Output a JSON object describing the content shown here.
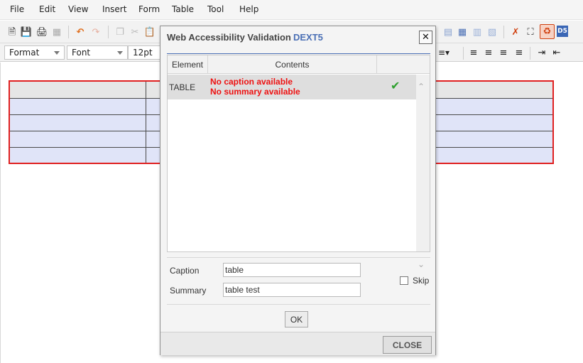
{
  "menubar": {
    "items": [
      "File",
      "Edit",
      "View",
      "Insert",
      "Form",
      "Table",
      "Tool",
      "Help"
    ]
  },
  "toolbar": {
    "format_label": "Format",
    "font_label": "Font",
    "size_label": "12pt",
    "icons": [
      "new-document-icon",
      "save-icon",
      "print-icon",
      "print-preview-icon",
      "undo-icon",
      "redo-icon",
      "copy-icon",
      "cut-icon",
      "paste-icon",
      "table-icon",
      "accessibility-icon",
      "dext5-icon",
      "list-icon",
      "align-left-icon",
      "align-center-icon",
      "align-right-icon",
      "align-justify-icon",
      "indent-icon",
      "outdent-icon"
    ]
  },
  "dialog": {
    "title": "Web Accessibility Validation",
    "brand": "DEXT5",
    "grid": {
      "columns": [
        "Element",
        "Contents"
      ],
      "rows": [
        {
          "element": "TABLE",
          "messages": [
            "No caption available",
            "No summary available"
          ],
          "status": "check"
        }
      ]
    },
    "caption_label": "Caption",
    "caption_value": "table",
    "summary_label": "Summary",
    "summary_value": "table test",
    "skip_label": "Skip",
    "skip_checked": false,
    "ok_label": "OK",
    "close_label": "CLOSE"
  },
  "colors": {
    "accent": "#4a6fb5",
    "error": "#ee1111",
    "check": "#2ea02e",
    "table_border": "#e02020"
  }
}
